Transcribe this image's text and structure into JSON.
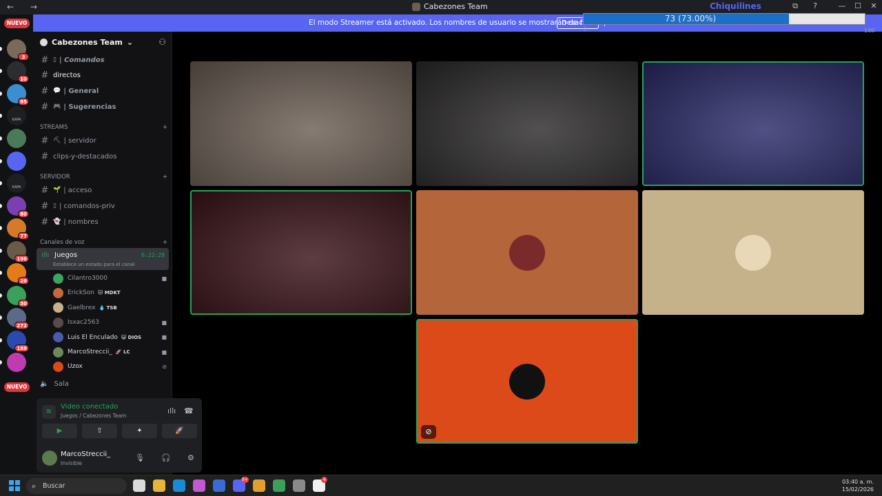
{
  "window": {
    "title": "Cabezones Team",
    "nav": "← →",
    "controls": {
      "screen": "⧉",
      "help": "?",
      "minimize": "—",
      "maximize": "☐",
      "close": "✕"
    }
  },
  "streamer_banner": {
    "message": "El modo Streamer está activado. Los nombres de usuario se mostrarán de forma parcial.",
    "button": "Desacti..."
  },
  "progress_overlay": {
    "title": "Chiquilines",
    "value_text": "73 (73.00%)",
    "fraction": 0.73,
    "min": "0",
    "max": "100"
  },
  "rail": {
    "new_top": "NUEVO",
    "new_bottom": "NUEVO",
    "servers": [
      {
        "badge": "3",
        "color": "#7a6a5a"
      },
      {
        "badge": "10",
        "color": "#2b2d31"
      },
      {
        "badge": "95",
        "color": "#3a8fd0"
      },
      {
        "badge": "",
        "label": "KAPA",
        "color": "#1e1f22"
      },
      {
        "badge": "",
        "color": "#4a7a5a"
      },
      {
        "badge": "",
        "color": "#5865f2"
      },
      {
        "badge": "",
        "label": "KAPA",
        "color": "#1e1f22"
      },
      {
        "badge": "80",
        "color": "#7a3fb0"
      },
      {
        "badge": "77",
        "color": "#d47a2a"
      },
      {
        "badge": "196",
        "color": "#6a5a4a"
      },
      {
        "badge": "28",
        "color": "#e37b1a"
      },
      {
        "badge": "30",
        "color": "#3aa05a"
      },
      {
        "badge": "272",
        "color": "#5a6a8a"
      },
      {
        "badge": "188",
        "color": "#2a4ab0"
      },
      {
        "badge": "",
        "color": "#c03ab0"
      }
    ]
  },
  "sidebar": {
    "server_name": "Cabezones Team",
    "channels_top": [
      {
        "emoji": "▯",
        "label": "| Comandos"
      },
      {
        "emoji": "",
        "label": "directos"
      },
      {
        "emoji": "💬",
        "label": "| General"
      },
      {
        "emoji": "🎮",
        "label": "| Sugerencias"
      }
    ],
    "streams_category": "STREAMS",
    "streams": [
      {
        "emoji": "⛏",
        "label": "| servidor"
      },
      {
        "emoji": "",
        "label": "clips-y-destacados"
      }
    ],
    "server_category": "SERVIDOR",
    "server_channels": [
      {
        "emoji": "🌱",
        "label": "| acceso"
      },
      {
        "emoji": "▯",
        "label": "| comandos-priv"
      },
      {
        "emoji": "👻",
        "label": "| nombres"
      }
    ],
    "voice_category": "Canales de voz",
    "voice_channel": {
      "name": "Juegos",
      "timer": "6:22:29",
      "status": "Establece un estado para el canal"
    },
    "voice_users": [
      {
        "name": "Cilantro3000",
        "tag": "",
        "cam": "■",
        "color": "#3ba55c"
      },
      {
        "name": "ErickSon",
        "tag": "🐱 MDKT",
        "cam": "",
        "color": "#c46a3a"
      },
      {
        "name": "Gaelbrex",
        "tag": "💧 TSB",
        "cam": "",
        "color": "#c8b08a"
      },
      {
        "name": "Isxac2563",
        "tag": "",
        "cam": "■",
        "color": "#5a4a4a"
      },
      {
        "name": "Luis El Enculado",
        "tag": "😺 DIOS",
        "cam": "■",
        "color": "#4a5ab0"
      },
      {
        "name": "MarcoStreccii_",
        "tag": "🚀 LC",
        "cam": "■",
        "color": "#6a8a5a"
      },
      {
        "name": "Uzox",
        "tag": "",
        "cam": "⊘",
        "color": "#d94a1a"
      }
    ],
    "sala": "Sala"
  },
  "voice_panel": {
    "status": "Video conectado",
    "location": "Juegos / Cabezones Team",
    "buttons": [
      "▶",
      "⇧",
      "✦",
      "🚀"
    ],
    "user": {
      "name": "MarcoStreccii_",
      "status": "Invisible"
    }
  },
  "tiles": [
    {
      "kind": "video",
      "color": "#6b5e54",
      "speaking": false
    },
    {
      "kind": "video",
      "color": "#2c2a2a",
      "speaking": false
    },
    {
      "kind": "video",
      "color": "#2a2a6a",
      "speaking": true
    },
    {
      "kind": "video",
      "color": "#3a1218",
      "speaking": true
    },
    {
      "kind": "avatar",
      "color": "#b5653a",
      "avatar_color": "#7a2a2a",
      "speaking": false
    },
    {
      "kind": "avatar",
      "color": "#c6b28a",
      "avatar_color": "#e8d8b8",
      "speaking": false
    },
    {
      "kind": "avatar",
      "color": "#dd4a1a",
      "avatar_color": "#111111",
      "speaking": true,
      "muted_icon": "⊘"
    }
  ],
  "taskbar": {
    "search": "Buscar",
    "time": "03:40 a. m.",
    "date": "15/02/2026",
    "apps": [
      {
        "color": "#dadada",
        "badge": ""
      },
      {
        "color": "#e8b53a",
        "badge": ""
      },
      {
        "color": "#1a8ad4",
        "badge": ""
      },
      {
        "color": "#c05ad0",
        "badge": ""
      },
      {
        "color": "#3a6ad4",
        "badge": ""
      },
      {
        "color": "#5865f2",
        "badge": "9+"
      },
      {
        "color": "#e0a030",
        "badge": ""
      },
      {
        "color": "#3aa05a",
        "badge": ""
      },
      {
        "color": "#8a8a8a",
        "badge": ""
      },
      {
        "color": "#f0f0f0",
        "badge": "4"
      }
    ]
  }
}
